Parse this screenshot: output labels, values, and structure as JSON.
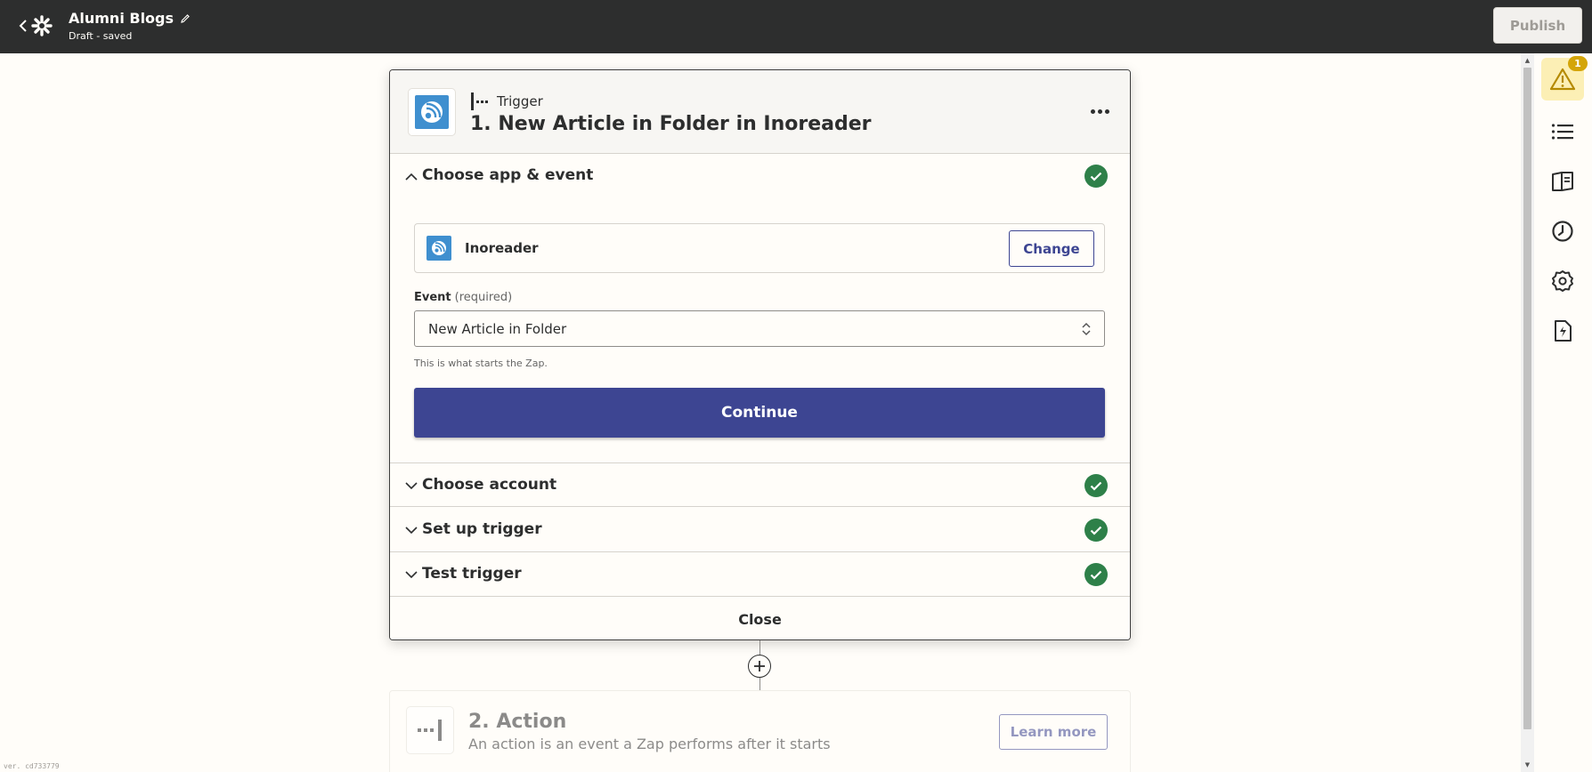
{
  "header": {
    "zap_name": "Alumni Blogs",
    "status": "Draft - saved",
    "publish_label": "Publish"
  },
  "sidebar": {
    "alerts_count": "1",
    "icons": [
      "warning-icon",
      "outline-list-icon",
      "guide-book-icon",
      "history-clock-icon",
      "settings-gear-icon",
      "zap-file-icon"
    ]
  },
  "trigger": {
    "type_label": "Trigger",
    "title": "1. New Article in Folder in Inoreader",
    "sections": [
      {
        "label": "Choose app & event",
        "complete": true,
        "expanded": true
      },
      {
        "label": "Choose account",
        "complete": true,
        "expanded": false
      },
      {
        "label": "Set up trigger",
        "complete": true,
        "expanded": false
      },
      {
        "label": "Test trigger",
        "complete": true,
        "expanded": false
      }
    ],
    "app_name": "Inoreader",
    "change_label": "Change",
    "event_label": "Event",
    "event_required": "(required)",
    "event_value": "New Article in Folder",
    "help_text": "This is what starts the Zap.",
    "continue_label": "Continue",
    "close_label": "Close"
  },
  "action": {
    "title": "2. Action",
    "subtitle": "An action is an event a Zap performs after it starts",
    "learn_more_label": "Learn more"
  },
  "version": "ver. cd733779",
  "colors": {
    "topbar": "#2d2e2e",
    "primary": "#3d4592",
    "success": "#2e8049",
    "warning": "#d4a509",
    "inoreader": "#3f8fcf"
  }
}
